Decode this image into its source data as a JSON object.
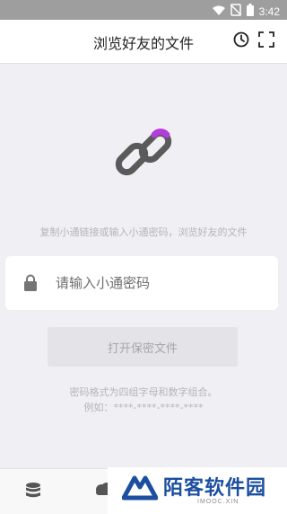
{
  "status_bar": {
    "time": "3:42"
  },
  "header": {
    "title": "浏览好友的文件"
  },
  "main": {
    "hint": "复制小通链接或输入小通密码，浏览好友的文件",
    "code_input": {
      "placeholder": "请输入小通密码",
      "value": ""
    },
    "open_button_label": "打开保密文件",
    "format_note_line1": "密码格式为四组字母和数字组合。",
    "format_note_line2": "例如：****-****-****-****"
  },
  "watermark": {
    "name": "陌客软件园",
    "url": "IMOOC.XIN"
  },
  "colors": {
    "accent_purple": "#b43cdc",
    "link_gray": "#5a5a5a",
    "watermark_blue": "#1c4fa0"
  }
}
